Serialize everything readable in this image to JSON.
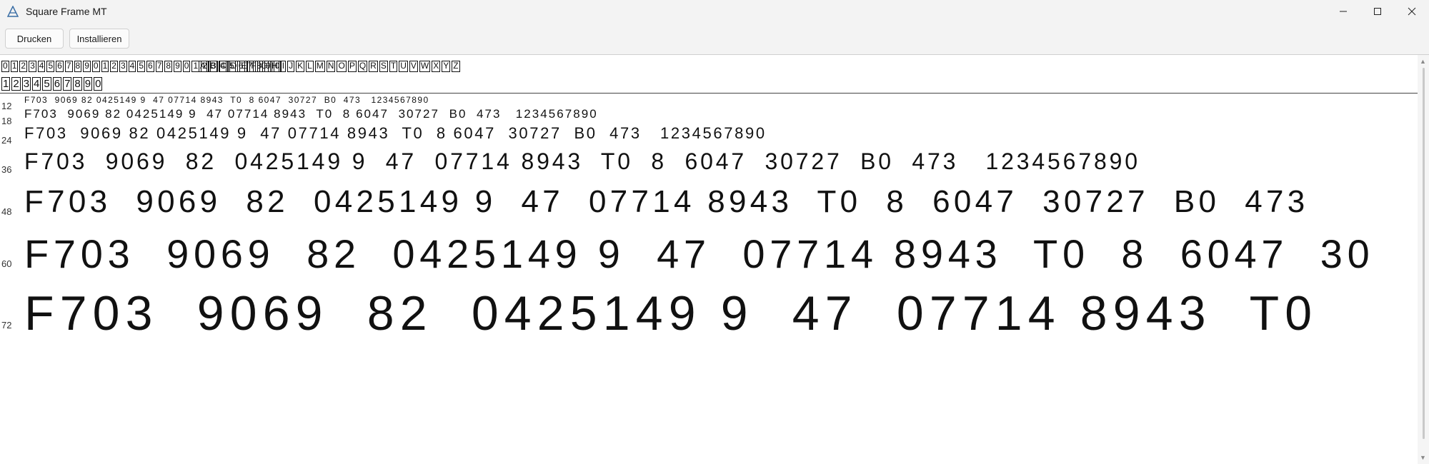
{
  "window": {
    "title": "Square Frame MT",
    "app_icon": "font-viewer-icon"
  },
  "toolbar": {
    "print_label": "Drucken",
    "install_label": "Installieren"
  },
  "charset": {
    "digits_line": "0123456789012345678901234567890",
    "letters_line": "ABCDEFGHIJKLMNOPQRSTUVWXYZ",
    "digits_line_2": "1234567890"
  },
  "samples": [
    {
      "size": "12",
      "text": "F703  9069 82 0425149 9  47 07714 8943  T0  8 6047  30727  B0  473   1234567890"
    },
    {
      "size": "18",
      "text": "F703  9069 82 0425149 9  47 07714 8943  T0  8 6047  30727  B0  473   1234567890"
    },
    {
      "size": "24",
      "text": "F703  9069 82 0425149 9  47 07714 8943  T0  8 6047  30727  B0  473   1234567890"
    },
    {
      "size": "36",
      "text": "F703  9069  82  0425149 9  47  07714 8943  T0  8  6047  30727  B0  473   1234567890"
    },
    {
      "size": "48",
      "text": "F703  9069  82  0425149 9  47  07714 8943  T0  8  6047  30727  B0  473"
    },
    {
      "size": "60",
      "text": "F703  9069  82  0425149 9  47  07714 8943  T0  8  6047  30"
    },
    {
      "size": "72",
      "text": "F703  9069  82  0425149 9  47  07714 8943  T0"
    }
  ]
}
